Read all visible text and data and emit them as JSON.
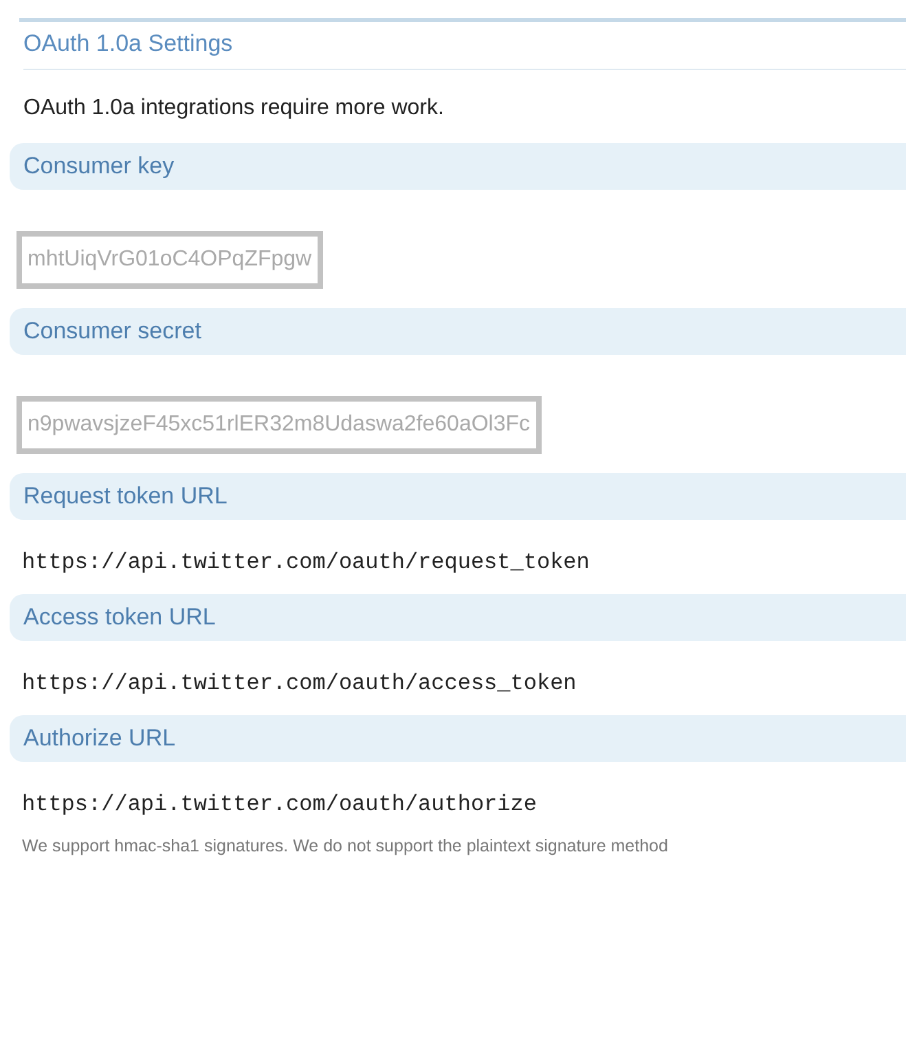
{
  "title": "OAuth 1.0a Settings",
  "description": "OAuth 1.0a integrations require more work.",
  "sections": [
    {
      "label": "Consumer key",
      "kind": "field",
      "value": "mhtUiqVrG01oC4OPqZFpgw"
    },
    {
      "label": "Consumer secret",
      "kind": "field",
      "value": "n9pwavsjzeF45xc51rlER32m8Udaswa2fe60aOl3Fc"
    },
    {
      "label": "Request token URL",
      "kind": "url",
      "value": "https://api.twitter.com/oauth/request_token"
    },
    {
      "label": "Access token URL",
      "kind": "url",
      "value": "https://api.twitter.com/oauth/access_token"
    },
    {
      "label": "Authorize URL",
      "kind": "url",
      "value": "https://api.twitter.com/oauth/authorize"
    }
  ],
  "note": "We support hmac-sha1 signatures. We do not support the plaintext signature method"
}
